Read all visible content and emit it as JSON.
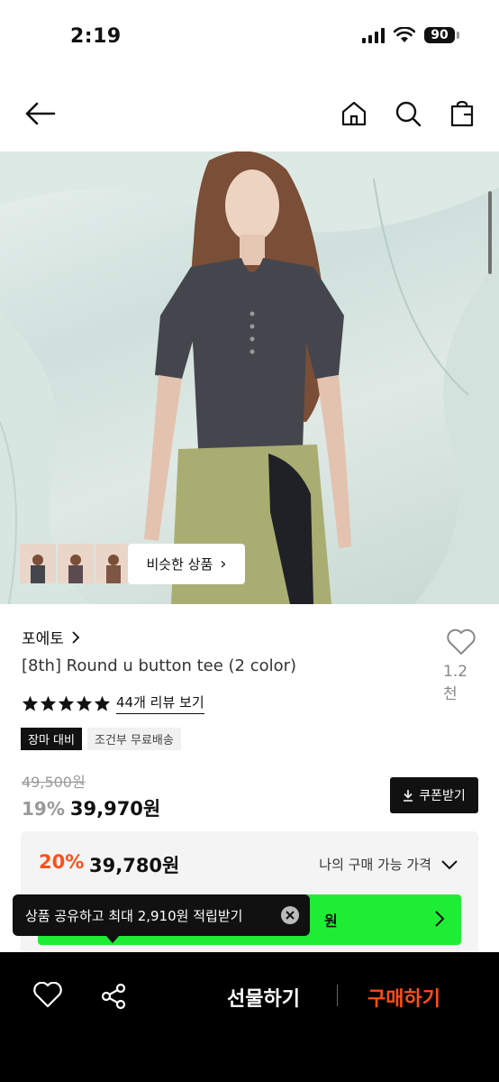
{
  "status": {
    "time": "2:19",
    "battery": "90"
  },
  "nav": {
    "back_icon": "arrow-left-icon",
    "home_icon": "home-icon",
    "search_icon": "search-icon",
    "bag_icon": "shopping-bag-icon"
  },
  "hero": {
    "similar_label": "비슷한 상품",
    "similar_chevron": "›"
  },
  "product": {
    "brand": "포에토",
    "title": "[8th] Round u button tee (2 color)",
    "wish_count": "1.2천",
    "review_link": "44개 리뷰 보기",
    "tags": [
      "장마 대비",
      "조건부 무료배송"
    ],
    "original_price": "49,500원",
    "discount": "19%",
    "price": "39,970원",
    "coupon_label": "쿠폰받기"
  },
  "my_price": {
    "discount": "20%",
    "price": "39,780원",
    "label": "나의 구매 가능 가격",
    "green_text": "원"
  },
  "tooltip": {
    "text": "상품 공유하고 최대 2,910원 적립받기"
  },
  "bottom": {
    "gift_label": "선물하기",
    "buy_label": "구매하기"
  },
  "colors": {
    "accent": "#ff4f17",
    "green": "#1eed35",
    "dark": "#111111"
  }
}
